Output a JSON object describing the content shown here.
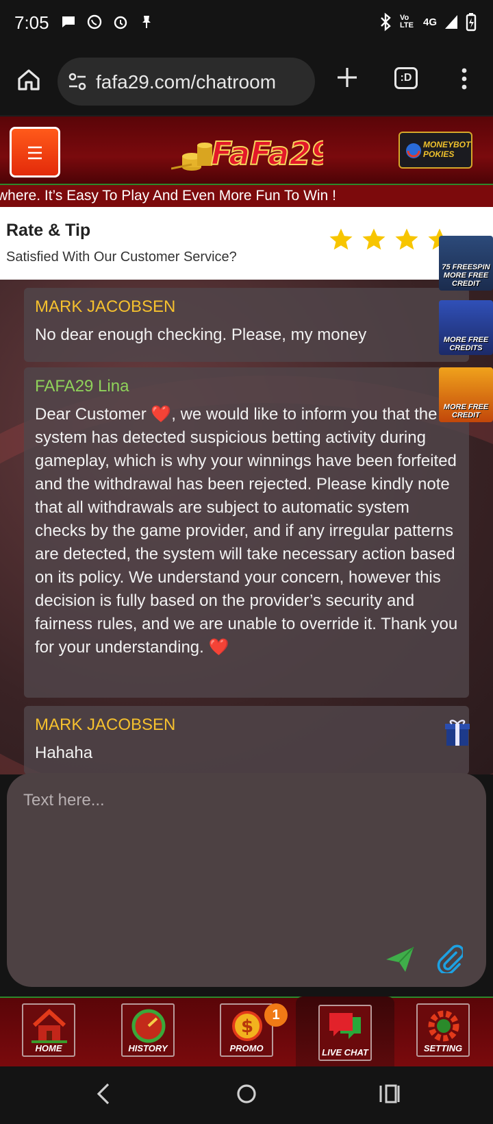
{
  "status_bar": {
    "time": "7:05",
    "network": "4G",
    "volte": "Vo LTE"
  },
  "browser": {
    "url": "fafa29.com/chatroom",
    "tab_icon_text": ":D"
  },
  "header": {
    "menu_icon": "hamburger-icon",
    "logo_text": "FaFa29",
    "promo_badge_text": "MONEYBOT POKIES"
  },
  "marquee": {
    "text": "where. It’s Easy To Play And Even More Fun To Win !"
  },
  "rate": {
    "title": "Rate & Tip",
    "subtitle": "Satisfied With Our Customer Service?",
    "stars_visible": 4
  },
  "side_promos": [
    {
      "label": "75 FREESPIN MORE FREE CREDIT"
    },
    {
      "label": "MORE FREE CREDITS"
    },
    {
      "label": "MORE FREE CREDIT"
    }
  ],
  "messages": [
    {
      "author": "MARK JACOBSEN",
      "role": "user",
      "text": "No dear enough checking. Please, my money"
    },
    {
      "author": "FAFA29 Lina",
      "role": "agent",
      "text": "Dear Customer ❤️, we would like to inform you that the system has detected suspicious betting activity during gameplay, which is why your winnings have been forfeited and the withdrawal has been rejected. Please kindly note that all withdrawals are subject to automatic system checks by the game provider, and if any irregular patterns are detected, the system will take necessary action based on its policy. We understand your concern, however this decision is fully based on the provider’s security and fairness rules, and we are unable to override it. Thank you for your understanding. ❤️"
    },
    {
      "author": "MARK JACOBSEN",
      "role": "user",
      "text": "Hahaha"
    }
  ],
  "composer": {
    "placeholder": "Text here..."
  },
  "bottom_nav": {
    "items": [
      {
        "label": "HOME"
      },
      {
        "label": "HISTORY"
      },
      {
        "label": "PROMO"
      },
      {
        "label": "LIVE CHAT"
      },
      {
        "label": "SETTING"
      }
    ],
    "promo_badge": "1"
  },
  "colors": {
    "user_name": "#f6c12e",
    "agent_name": "#8fd25a",
    "header_red": "#7a0a0d",
    "send_green": "#3fae4a",
    "attach_blue": "#1da1e2"
  }
}
